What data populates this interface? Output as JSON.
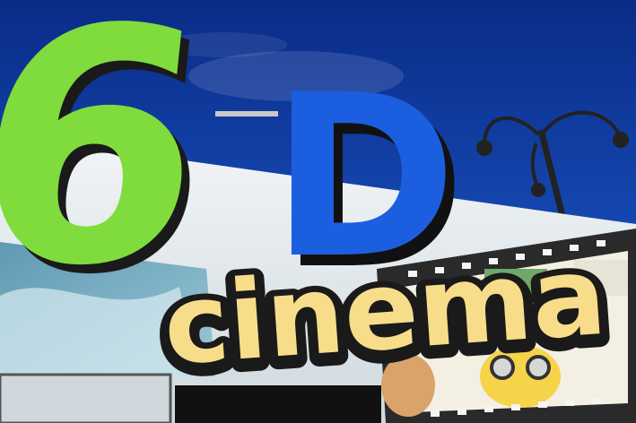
{
  "sign": {
    "big_number": "6",
    "big_letter": "D",
    "word": "cinema"
  },
  "colors": {
    "sky_top": "#0b2f8f",
    "sky_bottom": "#1e5fd6",
    "green": "#7fdc3b",
    "blue": "#1a5fe0",
    "yellow": "#f7dd8a",
    "dark": "#1a1a1a",
    "wall": "#e9eef1"
  }
}
